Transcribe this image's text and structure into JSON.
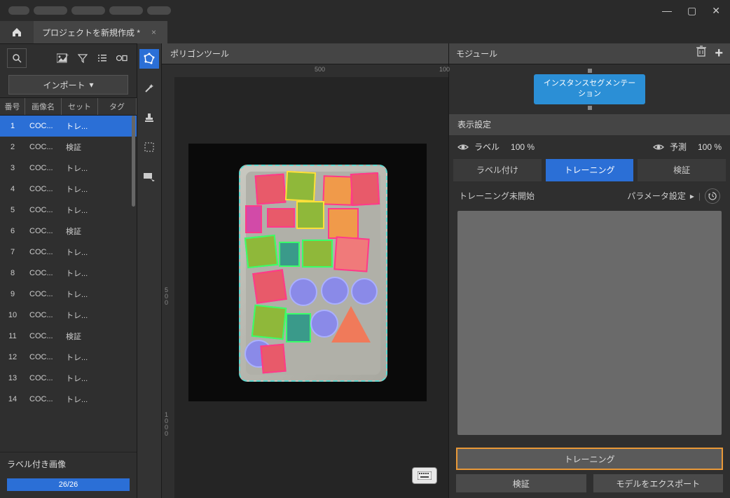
{
  "titlebar": {
    "project_name": "プロジェクトを新規作成 *"
  },
  "left": {
    "import_label": "インポート",
    "columns": {
      "num": "番号",
      "name": "画像名",
      "set": "セット",
      "tag": "タグ"
    },
    "rows": [
      {
        "num": "1",
        "name": "COC...",
        "set": "トレ..."
      },
      {
        "num": "2",
        "name": "COC...",
        "set": "検証"
      },
      {
        "num": "3",
        "name": "COC...",
        "set": "トレ..."
      },
      {
        "num": "4",
        "name": "COC...",
        "set": "トレ..."
      },
      {
        "num": "5",
        "name": "COC...",
        "set": "トレ..."
      },
      {
        "num": "6",
        "name": "COC...",
        "set": "検証"
      },
      {
        "num": "7",
        "name": "COC...",
        "set": "トレ..."
      },
      {
        "num": "8",
        "name": "COC...",
        "set": "トレ..."
      },
      {
        "num": "9",
        "name": "COC...",
        "set": "トレ..."
      },
      {
        "num": "10",
        "name": "COC...",
        "set": "トレ..."
      },
      {
        "num": "11",
        "name": "COC...",
        "set": "検証"
      },
      {
        "num": "12",
        "name": "COC...",
        "set": "トレ..."
      },
      {
        "num": "13",
        "name": "COC...",
        "set": "トレ..."
      },
      {
        "num": "14",
        "name": "COC...",
        "set": "トレ..."
      }
    ],
    "footer_label": "ラベル付き画像",
    "progress_text": "26/26"
  },
  "canvas": {
    "header": "ポリゴンツール",
    "ruler_500": "500",
    "ruler_1000": "100",
    "ruler_v_500": "5\n0\n0",
    "ruler_v_1000": "1\n0\n0\n0"
  },
  "right": {
    "header": "モジュール",
    "module_chip": "インスタンスセグメンテー\nション",
    "display_settings": "表示設定",
    "label_text": "ラベル",
    "label_pct": "100 %",
    "predict_text": "予測",
    "predict_pct": "100 %",
    "tab_label": "ラベル付け",
    "tab_train": "トレーニング",
    "tab_val": "検証",
    "train_status": "トレーニング未開始",
    "param_setting": "パラメータ設定",
    "big_train": "トレーニング",
    "btn_val": "検証",
    "btn_export": "モデルをエクスポート"
  }
}
